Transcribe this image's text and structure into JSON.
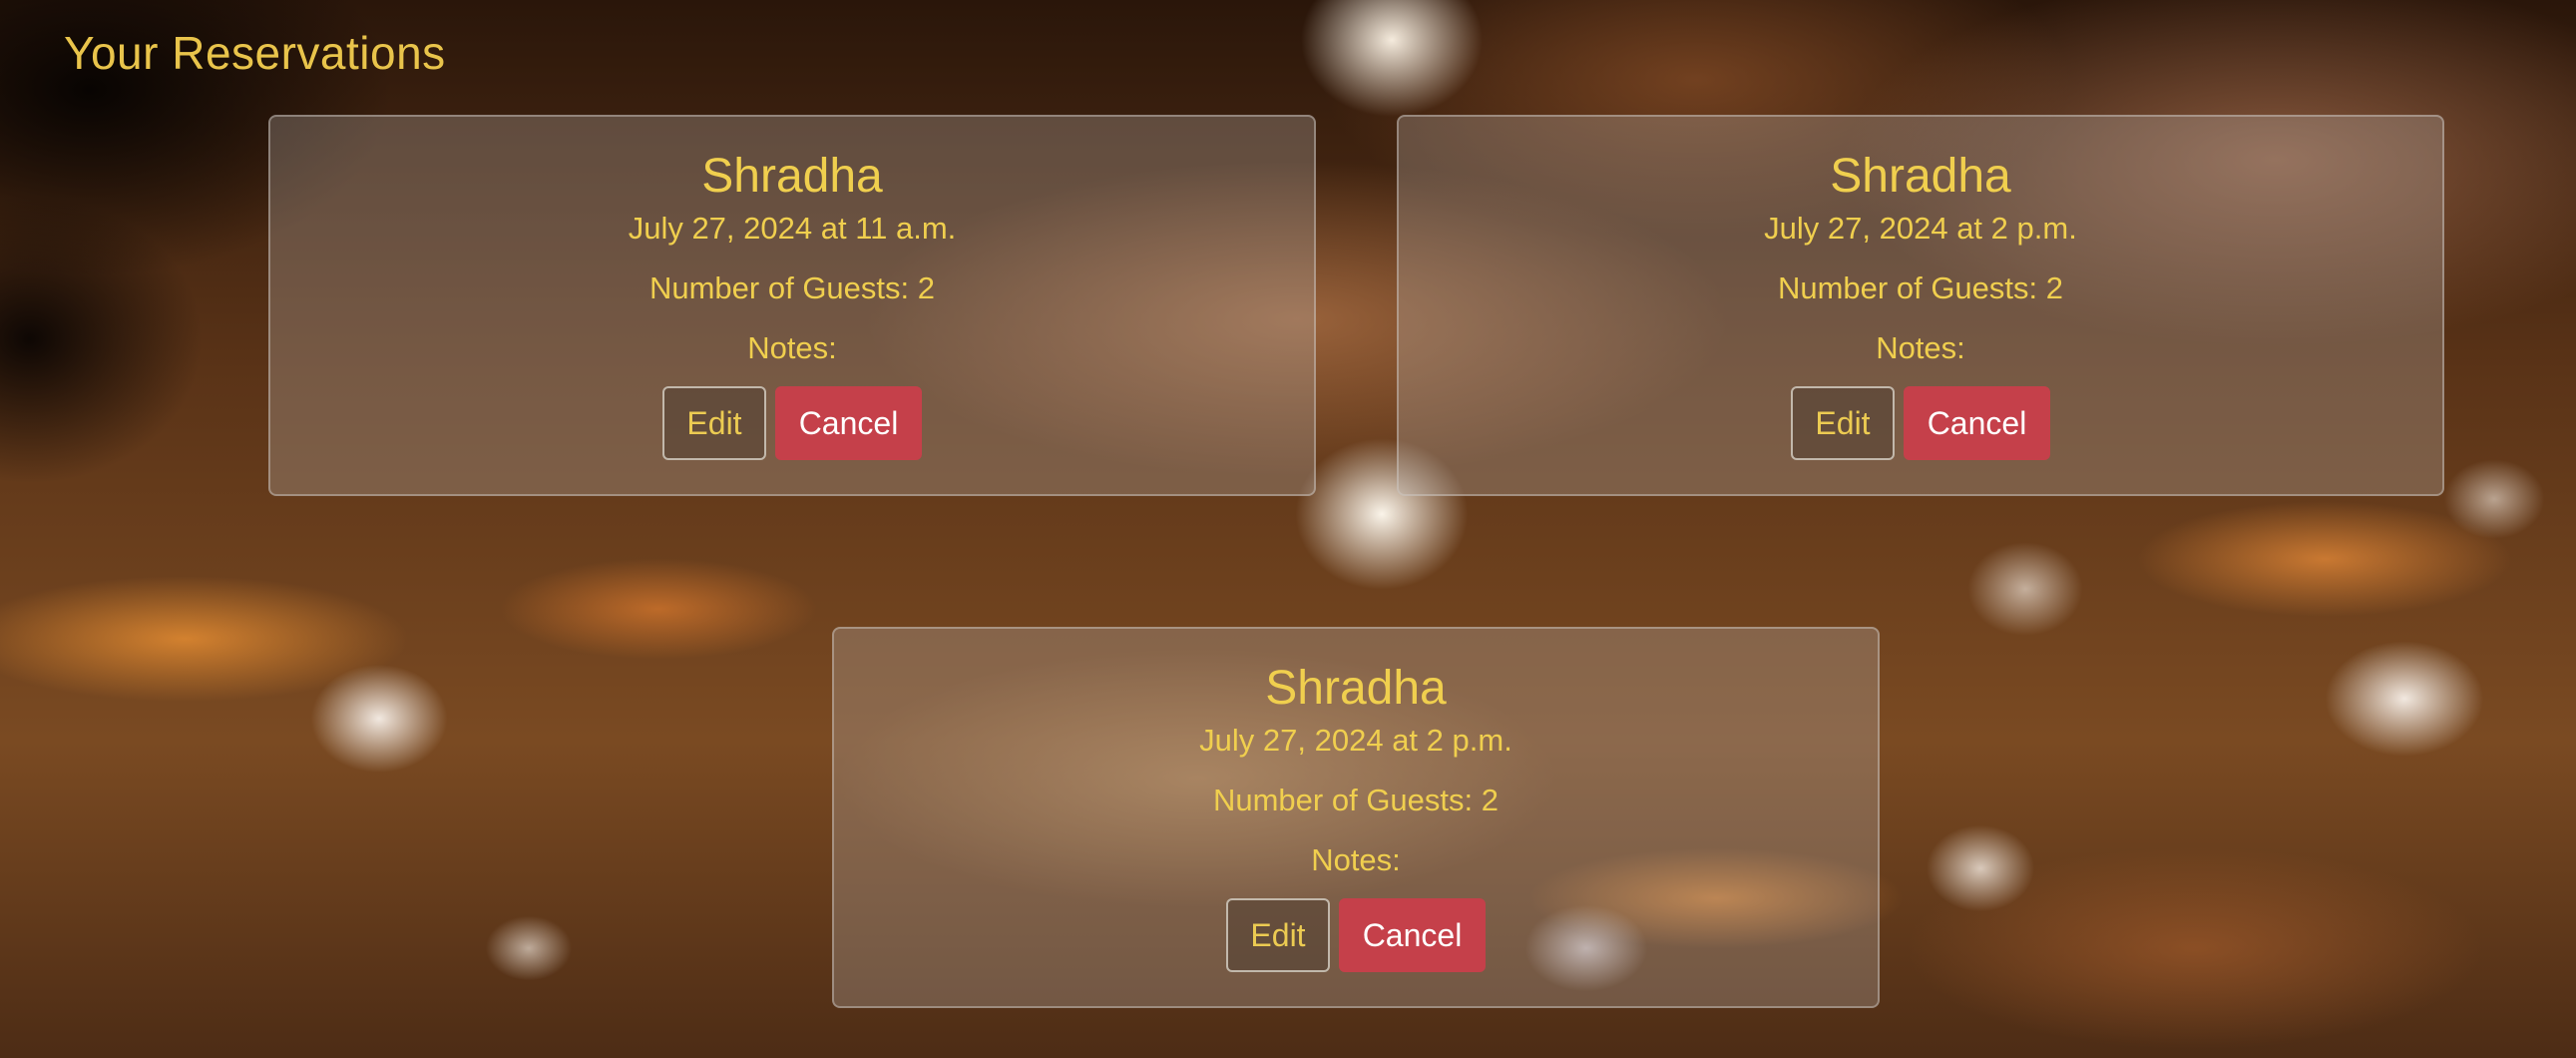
{
  "page": {
    "title": "Your Reservations"
  },
  "reservations": [
    {
      "name": "Shradha",
      "datetime": "July 27, 2024 at 11 a.m.",
      "guests_text": "Number of Guests: 2",
      "notes_text": "Notes:",
      "edit_label": "Edit",
      "cancel_label": "Cancel"
    },
    {
      "name": "Shradha",
      "datetime": "July 27, 2024 at 2 p.m.",
      "guests_text": "Number of Guests: 2",
      "notes_text": "Notes:",
      "edit_label": "Edit",
      "cancel_label": "Cancel"
    },
    {
      "name": "Shradha",
      "datetime": "July 27, 2024 at 2 p.m.",
      "guests_text": "Number of Guests: 2",
      "notes_text": "Notes:",
      "edit_label": "Edit",
      "cancel_label": "Cancel"
    }
  ],
  "colors": {
    "accent_text": "#e9c44b",
    "cancel_button": "#c5404a"
  }
}
